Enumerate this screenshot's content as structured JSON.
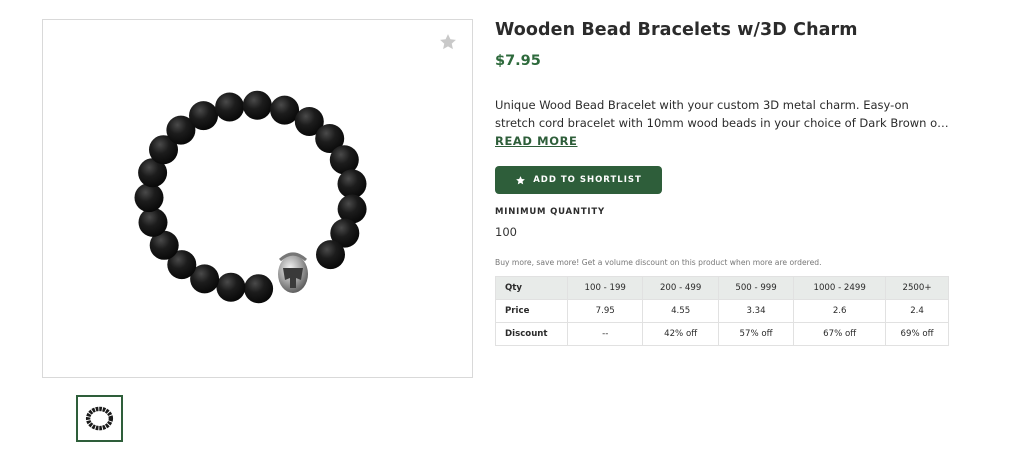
{
  "product": {
    "title": "Wooden Bead Bracelets w/3D Charm",
    "price": "$7.95",
    "description": "Unique Wood Bead Bracelet with your custom 3D metal charm. Easy-on stretch cord bracelet with 10mm wood beads in your choice of Dark Brown or Black. Prices inclu...",
    "read_more": "READ MORE",
    "image_icon": "bracelet-image",
    "favorite_icon": "star-icon"
  },
  "actions": {
    "shortlist_label": "ADD TO SHORTLIST",
    "shortlist_icon": "star-icon"
  },
  "minimum_quantity": {
    "label": "MINIMUM QUANTITY",
    "value": "100"
  },
  "pricing": {
    "note": "Buy more, save more! Get a volume discount on this product when more are ordered.",
    "header": [
      "Qty",
      "100 - 199",
      "200 - 499",
      "500 - 999",
      "1000 - 2499",
      "2500+"
    ],
    "rows": [
      [
        "Price",
        "7.95",
        "4.55",
        "3.34",
        "2.6",
        "2.4"
      ],
      [
        "Discount",
        "--",
        "42% off",
        "57% off",
        "67% off",
        "69% off"
      ]
    ]
  },
  "colors": {
    "accent": "#2e5e3a",
    "price": "#2e6a3c",
    "table_header_bg": "#e8ebe9"
  }
}
